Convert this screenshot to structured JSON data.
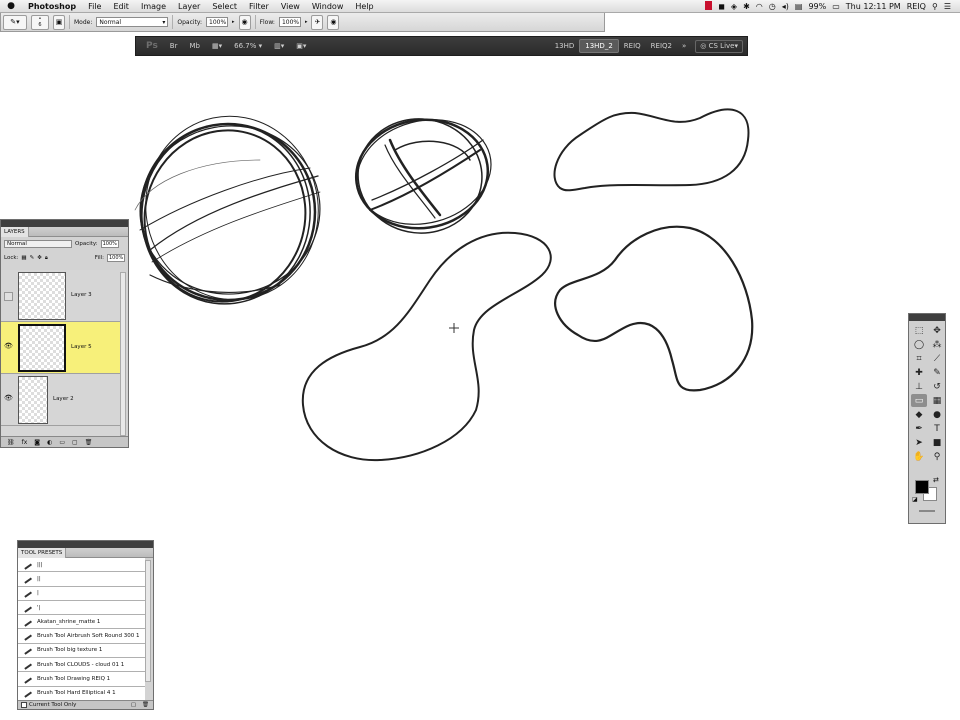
{
  "menubar": {
    "app_name": "Photoshop",
    "menus": [
      "File",
      "Edit",
      "Image",
      "Layer",
      "Select",
      "Filter",
      "View",
      "Window",
      "Help"
    ],
    "battery": "99%",
    "clock": "Thu 12:11 PM",
    "user": "REIQ"
  },
  "options_bar": {
    "brush_size": "6",
    "mode_label": "Mode:",
    "mode_value": "Normal",
    "opacity_label": "Opacity:",
    "opacity_value": "100%",
    "flow_label": "Flow:",
    "flow_value": "100%"
  },
  "app_bar": {
    "logo": "Ps",
    "zoom": "66.7%",
    "workspaces": [
      "13HD",
      "13HD_2",
      "REIQ",
      "REIQ2"
    ],
    "active_workspace": "13HD_2",
    "more": "»",
    "cs_live": "CS Live"
  },
  "layers_panel": {
    "title": "LAYERS",
    "blend_mode": "Normal",
    "opacity_label": "Opacity:",
    "opacity_value": "100%",
    "lock_label": "Lock:",
    "fill_label": "Fill:",
    "fill_value": "100%",
    "layers": [
      {
        "name": "Layer 3",
        "visible": false,
        "selected": false
      },
      {
        "name": "Layer 5",
        "visible": true,
        "selected": true
      },
      {
        "name": "Layer 2",
        "visible": true,
        "selected": false
      }
    ]
  },
  "tool_presets_panel": {
    "title": "TOOL PRESETS",
    "items": [
      "|||",
      "||",
      "|",
      "'|",
      "Akatan_shrine_matte 1",
      "Brush Tool Airbrush Soft Round 300 1",
      "Brush Tool big texture 1",
      "Brush Tool CLOUDS - cloud 01 1",
      "Brush Tool Drawing REIQ 1",
      "Brush Tool Hard Elliptical 4 1"
    ],
    "current_tool_only": "Current Tool Only"
  },
  "toolbox": {
    "tools": [
      {
        "icon": "marquee-icon",
        "glyph": "⬚"
      },
      {
        "icon": "move-icon",
        "glyph": "✥"
      },
      {
        "icon": "lasso-icon",
        "glyph": "◯"
      },
      {
        "icon": "magic-wand-icon",
        "glyph": "⁂"
      },
      {
        "icon": "crop-icon",
        "glyph": "⌗"
      },
      {
        "icon": "eyedropper-icon",
        "glyph": "⟋"
      },
      {
        "icon": "healing-brush-icon",
        "glyph": "✚"
      },
      {
        "icon": "brush-icon",
        "glyph": "✎"
      },
      {
        "icon": "clone-stamp-icon",
        "glyph": "⊥"
      },
      {
        "icon": "history-brush-icon",
        "glyph": "↺"
      },
      {
        "icon": "eraser-icon",
        "glyph": "▭"
      },
      {
        "icon": "gradient-icon",
        "glyph": "▦"
      },
      {
        "icon": "blur-icon",
        "glyph": "◆"
      },
      {
        "icon": "dodge-icon",
        "glyph": "●"
      },
      {
        "icon": "pen-icon",
        "glyph": "✒"
      },
      {
        "icon": "type-icon",
        "glyph": "T"
      },
      {
        "icon": "path-selection-icon",
        "glyph": "➤"
      },
      {
        "icon": "shape-icon",
        "glyph": "■"
      },
      {
        "icon": "hand-icon",
        "glyph": "✋"
      },
      {
        "icon": "zoom-icon",
        "glyph": "⚲"
      }
    ],
    "foreground_color": "#000000",
    "background_color": "#ffffff"
  },
  "colors": {
    "selected_layer": "#f7f07a",
    "appbar_bg": "#333333"
  }
}
